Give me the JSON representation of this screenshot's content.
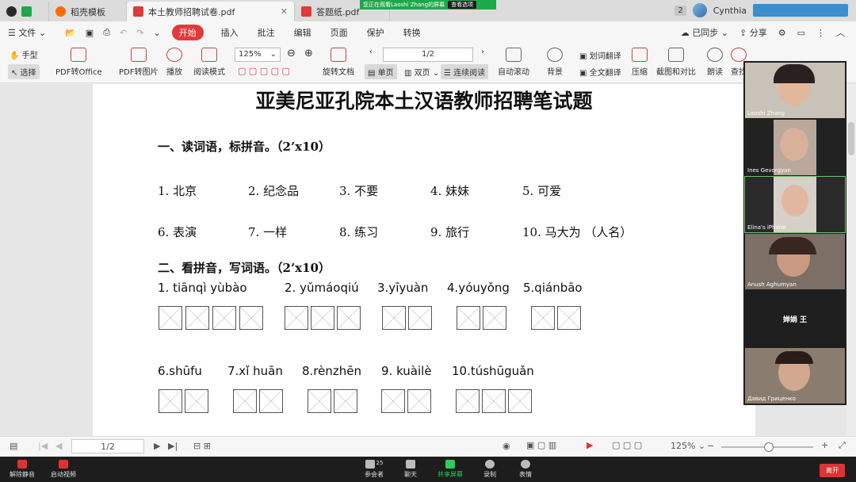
{
  "tabs": [
    {
      "label": "稻壳模板",
      "active": false
    },
    {
      "label": "本土教师招聘试卷.pdf",
      "active": true
    },
    {
      "label": "答题纸.pdf",
      "active": false
    }
  ],
  "share_banner": {
    "text": "您正在观看Laoshi Zhang的屏幕",
    "option": "查看选项"
  },
  "user": {
    "badge": "2",
    "name": "Cynthia"
  },
  "menu": {
    "file": "文件",
    "start": "开始",
    "items": [
      "插入",
      "批注",
      "编辑",
      "页面",
      "保护",
      "转换"
    ],
    "sync": "已同步",
    "share": "分享"
  },
  "toolbar": {
    "hand": "手型",
    "select": "选择",
    "pdf_office": "PDF转Office",
    "pdf_image": "PDF转图片",
    "play": "播放",
    "read_mode": "阅读模式",
    "zoom": "125%",
    "rotate": "旋转文档",
    "page": "1/2",
    "single": "单页",
    "double": "双页",
    "continuous": "连续阅读",
    "auto_scroll": "自动滚动",
    "background": "背景",
    "translate_word": "划词翻译",
    "translate_all": "全文翻译",
    "compress": "压缩",
    "screenshot": "截图和对比",
    "read_aloud": "朗读",
    "find": "查找"
  },
  "document": {
    "title": "亚美尼亚孔院本土汉语教师招聘笔试题",
    "section1": "一、读词语，标拼音。（2’x10）",
    "words_row1": [
      "1.  北京",
      "2.  纪念品",
      "3.  不要",
      "4.  妹妹",
      "5.  可爱"
    ],
    "words_row2": [
      "6.  表演",
      "7.  一样",
      "8.  练习",
      "9.  旅行",
      "10.  马大为 （人名）"
    ],
    "section2": "二、看拼音，写词语。（2’x10）",
    "pinyin_row1": [
      "1. tiānqì yùbào",
      "2. yǔmáoqiú",
      "3.yīyuàn",
      "4.yóuyǒng",
      "5.qiánbāo"
    ],
    "pinyin_row2": [
      "6.shūfu",
      "7.xǐ huān",
      "8.rènzhēn",
      "9. kuàilè",
      "10.túshūguǎn"
    ]
  },
  "participants": [
    {
      "name": "Laoshi Zhang"
    },
    {
      "name": "Ines Gevorgyan"
    },
    {
      "name": "Elina's iPhone"
    },
    {
      "name": "Anush Aghumyan"
    },
    {
      "name": "婵娟 王"
    },
    {
      "name": "Давид Гриценко"
    }
  ],
  "status": {
    "page": "1/2",
    "zoom": "125%"
  },
  "meeting": {
    "mute": "解除静音",
    "video": "启动视频",
    "participants": "参会者",
    "participant_count": "25",
    "chat": "聊天",
    "share_screen": "共享屏幕",
    "record": "录制",
    "reactions": "表情",
    "leave": "离开"
  }
}
